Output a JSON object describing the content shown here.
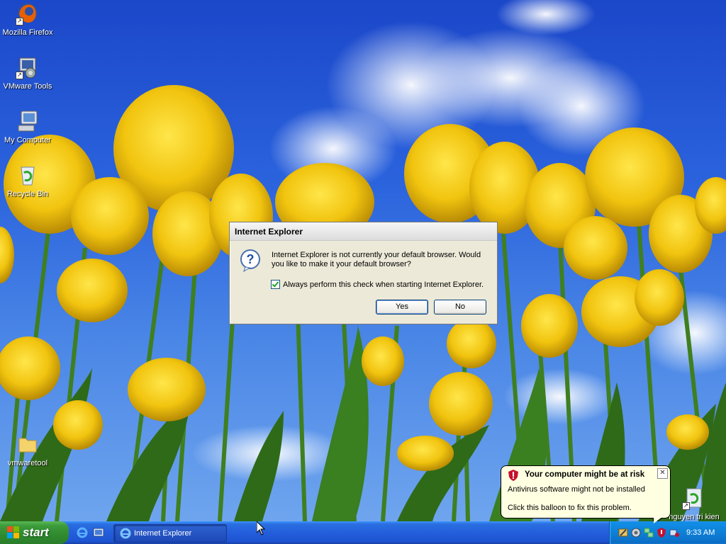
{
  "desktop": {
    "icons": [
      {
        "label": "Mozilla Firefox"
      },
      {
        "label": "VMware Tools"
      },
      {
        "label": "My Computer"
      },
      {
        "label": "Recycle Bin"
      },
      {
        "label": "vmwaretool"
      },
      {
        "label": "nguyen tri kien"
      }
    ]
  },
  "dialog": {
    "title": "Internet Explorer",
    "message": "Internet Explorer is not currently your default browser. Would you like to make it your default browser?",
    "checkbox_label": "Always perform this check when starting Internet Explorer.",
    "checkbox_checked": true,
    "yes_label": "Yes",
    "no_label": "No"
  },
  "balloon": {
    "title": "Your computer might be at risk",
    "line1": "Antivirus software might not be installed",
    "line2": "Click this balloon to fix this problem."
  },
  "taskbar": {
    "start_label": "start",
    "task_label": "Internet Explorer",
    "clock": "9:33 AM"
  },
  "colors": {
    "taskbar_blue": "#245edc",
    "start_green": "#3c9b3b",
    "dialog_bg": "#ece9d8",
    "balloon_bg": "#ffffe1"
  }
}
